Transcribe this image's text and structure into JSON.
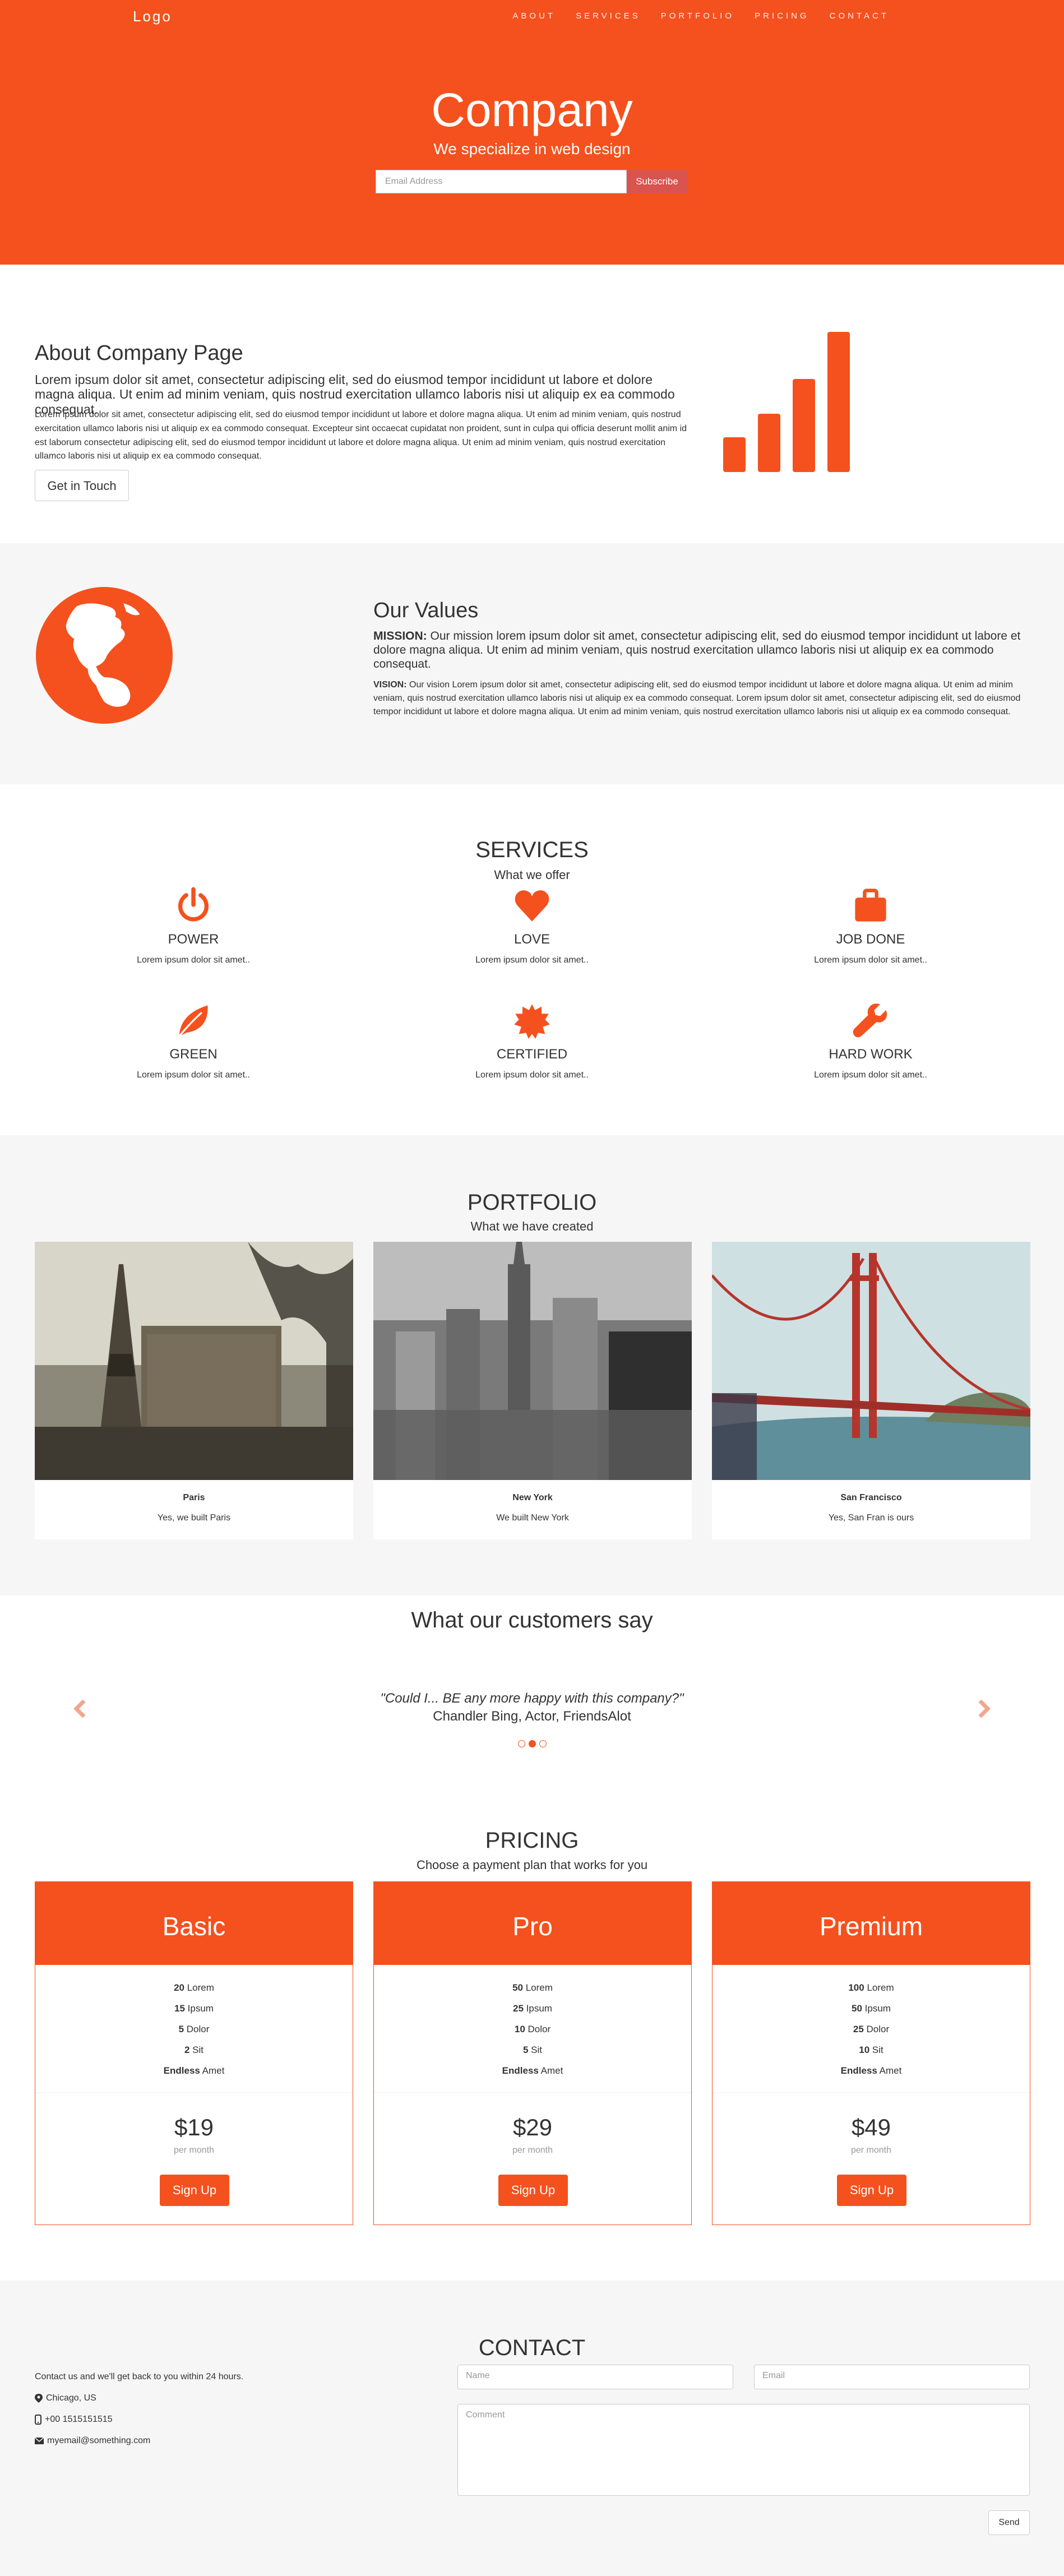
{
  "nav": {
    "logo": "Logo",
    "items": [
      "ABOUT",
      "SERVICES",
      "PORTFOLIO",
      "PRICING",
      "CONTACT"
    ]
  },
  "hero": {
    "title": "Company",
    "subtitle": "We specialize in web design",
    "email_placeholder": "Email Address",
    "subscribe_label": "Subscribe"
  },
  "about": {
    "title": "About Company Page",
    "lead": "Lorem ipsum dolor sit amet, consectetur adipiscing elit, sed do eiusmod tempor incididunt ut labore et dolore magna aliqua. Ut enim ad minim veniam, quis nostrud exercitation ullamco laboris nisi ut aliquip ex ea commodo consequat.",
    "body": "Lorem ipsum dolor sit amet, consectetur adipiscing elit, sed do eiusmod tempor incididunt ut labore et dolore magna aliqua. Ut enim ad minim veniam, quis nostrud exercitation ullamco laboris nisi ut aliquip ex ea commodo consequat. Excepteur sint occaecat cupidatat non proident, sunt in culpa qui officia deserunt mollit anim id est laborum consectetur adipiscing elit, sed do eiusmod tempor incididunt ut labore et dolore magna aliqua. Ut enim ad minim veniam, quis nostrud exercitation ullamco laboris nisi ut aliquip ex ea commodo consequat.",
    "button": "Get in Touch",
    "icon": "signal-bars-icon"
  },
  "values": {
    "title": "Our Values",
    "mission_label": "MISSION:",
    "mission": " Our mission lorem ipsum dolor sit amet, consectetur adipiscing elit, sed do eiusmod tempor incididunt ut labore et dolore magna aliqua. Ut enim ad minim veniam, quis nostrud exercitation ullamco laboris nisi ut aliquip ex ea commodo consequat.",
    "vision_label": "VISION:",
    "vision": " Our vision Lorem ipsum dolor sit amet, consectetur adipiscing elit, sed do eiusmod tempor incididunt ut labore et dolore magna aliqua. Ut enim ad minim veniam, quis nostrud exercitation ullamco laboris nisi ut aliquip ex ea commodo consequat. Lorem ipsum dolor sit amet, consectetur adipiscing elit, sed do eiusmod tempor incididunt ut labore et dolore magna aliqua. Ut enim ad minim veniam, quis nostrud exercitation ullamco laboris nisi ut aliquip ex ea commodo consequat.",
    "icon": "globe-icon"
  },
  "services": {
    "title": "SERVICES",
    "subtitle": "What we offer",
    "items": [
      {
        "name": "POWER",
        "text": "Lorem ipsum dolor sit amet..",
        "icon": "power-icon"
      },
      {
        "name": "LOVE",
        "text": "Lorem ipsum dolor sit amet..",
        "icon": "heart-icon"
      },
      {
        "name": "JOB DONE",
        "text": "Lorem ipsum dolor sit amet..",
        "icon": "briefcase-icon"
      },
      {
        "name": "GREEN",
        "text": "Lorem ipsum dolor sit amet..",
        "icon": "leaf-icon"
      },
      {
        "name": "CERTIFIED",
        "text": "Lorem ipsum dolor sit amet..",
        "icon": "certificate-icon"
      },
      {
        "name": "HARD WORK",
        "text": "Lorem ipsum dolor sit amet..",
        "icon": "wrench-icon"
      }
    ]
  },
  "portfolio": {
    "title": "PORTFOLIO",
    "subtitle": "What we have created",
    "items": [
      {
        "title": "Paris",
        "text": "Yes, we built Paris"
      },
      {
        "title": "New York",
        "text": "We built New York"
      },
      {
        "title": "San Francisco",
        "text": "Yes, San Fran is ours"
      }
    ]
  },
  "testimonials": {
    "title": "What our customers say",
    "quote": "\"Could I... BE any more happy with this company?\"",
    "author": "Chandler Bing, Actor, FriendsAlot"
  },
  "pricing": {
    "title": "PRICING",
    "subtitle": "Choose a payment plan that works for you",
    "plans": [
      {
        "name": "Basic",
        "features": [
          [
            "20",
            " Lorem"
          ],
          [
            "15",
            " Ipsum"
          ],
          [
            "5",
            " Dolor"
          ],
          [
            "2",
            " Sit"
          ],
          [
            "Endless",
            " Amet"
          ]
        ],
        "price": "$19",
        "period": "per month",
        "button": "Sign Up"
      },
      {
        "name": "Pro",
        "features": [
          [
            "50",
            " Lorem"
          ],
          [
            "25",
            " Ipsum"
          ],
          [
            "10",
            " Dolor"
          ],
          [
            "5",
            " Sit"
          ],
          [
            "Endless",
            " Amet"
          ]
        ],
        "price": "$29",
        "period": "per month",
        "button": "Sign Up"
      },
      {
        "name": "Premium",
        "features": [
          [
            "100",
            " Lorem"
          ],
          [
            "50",
            " Ipsum"
          ],
          [
            "25",
            " Dolor"
          ],
          [
            "10",
            " Sit"
          ],
          [
            "Endless",
            " Amet"
          ]
        ],
        "price": "$49",
        "period": "per month",
        "button": "Sign Up"
      }
    ]
  },
  "contact": {
    "title": "CONTACT",
    "intro": "Contact us and we'll get back to you within 24 hours.",
    "location": "Chicago, US",
    "phone": "+00 1515151515",
    "email": "myemail@something.com",
    "name_placeholder": "Name",
    "email_placeholder": "Email",
    "comment_placeholder": "Comment",
    "send_label": "Send"
  },
  "colors": {
    "accent": "#f4511e",
    "light_bg": "#f6f6f6",
    "subscribe": "#d9534f"
  }
}
